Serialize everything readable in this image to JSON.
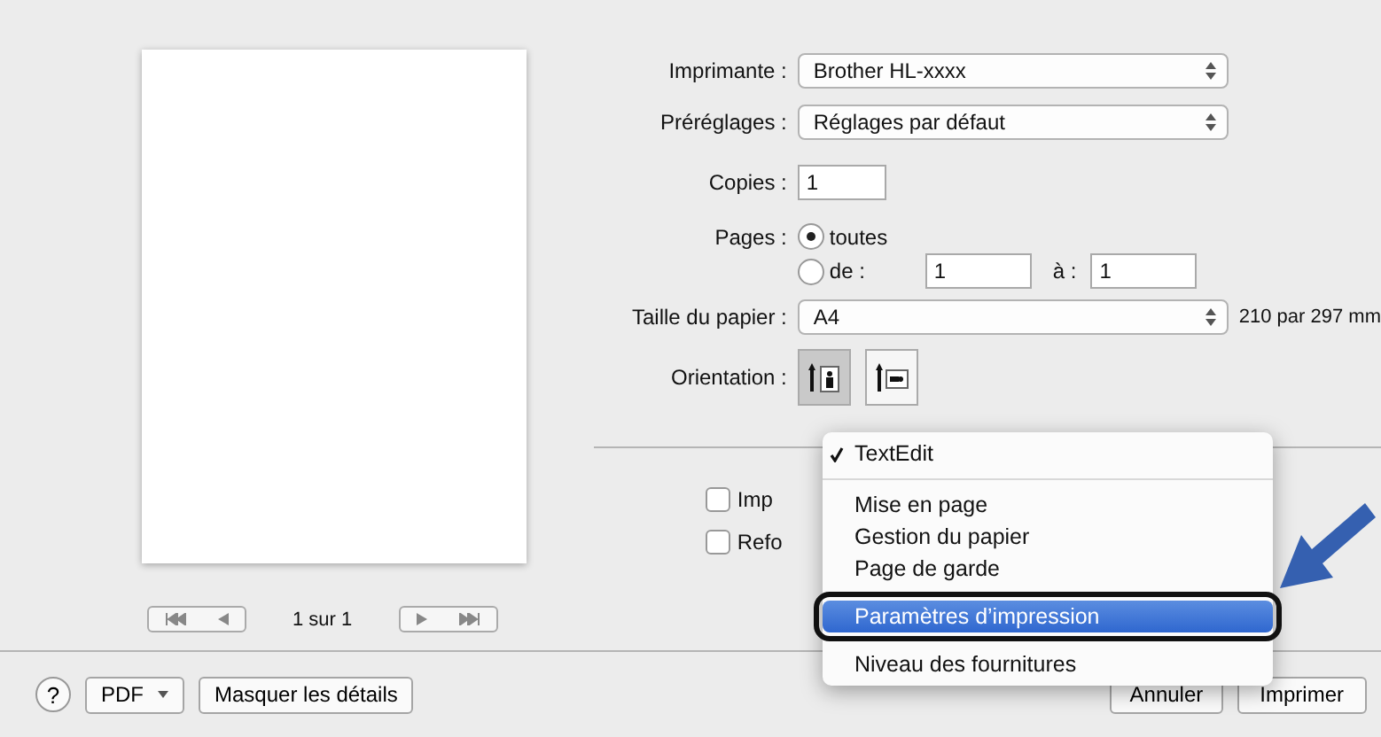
{
  "printer": {
    "label": "Imprimante :",
    "value": "Brother HL-xxxx"
  },
  "presets": {
    "label": "Préréglages :",
    "value": "Réglages par défaut"
  },
  "copies": {
    "label": "Copies :",
    "value": "1"
  },
  "pages": {
    "label": "Pages :",
    "options": [
      {
        "label": "toutes",
        "selected": true
      },
      {
        "label": "de :",
        "selected": false
      }
    ],
    "from": "1",
    "to_label": "à :",
    "to": "1"
  },
  "paper_size": {
    "label": "Taille du papier :",
    "value": "A4",
    "dimensions": "210 par 297 mm"
  },
  "orientation": {
    "label": "Orientation :",
    "options": [
      {
        "kind": "portrait",
        "selected": true
      },
      {
        "kind": "landscape",
        "selected": false
      }
    ]
  },
  "checkboxes": [
    {
      "label": "Imp",
      "checked": false
    },
    {
      "label": "Refo",
      "checked": false
    }
  ],
  "preview": {
    "page_count": "1 sur 1"
  },
  "menu": {
    "sections": [
      [
        {
          "label": "TextEdit",
          "checked": true,
          "selected": false
        }
      ],
      [
        {
          "label": "Mise en page",
          "checked": false,
          "selected": false
        },
        {
          "label": "Gestion du papier",
          "checked": false,
          "selected": false
        },
        {
          "label": "Page de garde",
          "checked": false,
          "selected": false
        }
      ],
      [
        {
          "label": "Paramètres d’impression",
          "checked": false,
          "selected": true
        }
      ],
      [
        {
          "label": "Niveau des fournitures",
          "checked": false,
          "selected": false
        }
      ]
    ]
  },
  "footer": {
    "help": "?",
    "pdf": "PDF",
    "details": "Masquer les détails",
    "cancel": "Annuler",
    "print": "Imprimer"
  }
}
